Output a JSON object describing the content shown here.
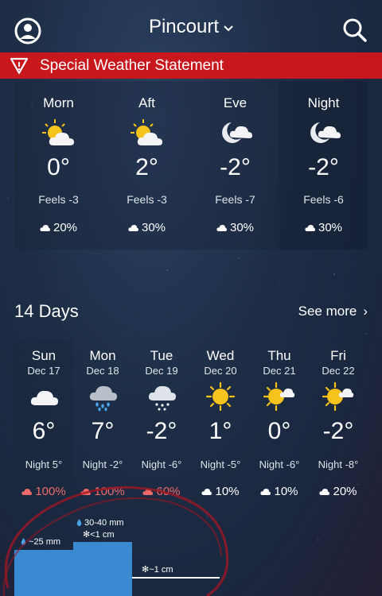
{
  "header": {
    "location": "Pincourt",
    "location_chevron": "⌄",
    "avatar_icon": "user-circle-icon",
    "search_icon": "search-icon"
  },
  "alert": {
    "text": "Special Weather Statement",
    "color": "#c8181d"
  },
  "periods": [
    {
      "label": "Morn",
      "temp": "0°",
      "feels": "Feels -3",
      "precip": "20%",
      "icon": "partly-sunny-icon"
    },
    {
      "label": "Aft",
      "temp": "2°",
      "feels": "Feels -3",
      "precip": "30%",
      "icon": "partly-sunny-icon"
    },
    {
      "label": "Eve",
      "temp": "-2°",
      "feels": "Feels -7",
      "precip": "30%",
      "icon": "moon-cloud-icon"
    },
    {
      "label": "Night",
      "temp": "-2°",
      "feels": "Feels -6",
      "precip": "30%",
      "icon": "moon-cloud-icon"
    }
  ],
  "fourteen_days": {
    "title": "14 Days",
    "see_more": "See more",
    "chevron": "›"
  },
  "days": [
    {
      "name": "Sun",
      "date": "Dec 17",
      "temp": "6°",
      "night": "Night 5°",
      "precip": "100%",
      "icon": "cloud-icon",
      "high": true
    },
    {
      "name": "Mon",
      "date": "Dec 18",
      "temp": "7°",
      "night": "Night -2°",
      "precip": "100%",
      "icon": "rain-cloud-icon",
      "high": true
    },
    {
      "name": "Tue",
      "date": "Dec 19",
      "temp": "-2°",
      "night": "Night -6°",
      "precip": "60%",
      "icon": "snow-cloud-icon",
      "high": true
    },
    {
      "name": "Wed",
      "date": "Dec 20",
      "temp": "1°",
      "night": "Night -5°",
      "precip": "10%",
      "icon": "sun-icon",
      "high": false
    },
    {
      "name": "Thu",
      "date": "Dec 21",
      "temp": "0°",
      "night": "Night -6°",
      "precip": "10%",
      "icon": "sun-cloud-icon",
      "high": false
    },
    {
      "name": "Fri",
      "date": "Dec 22",
      "temp": "-2°",
      "night": "Night -8°",
      "precip": "20%",
      "icon": "sun-cloud-icon",
      "high": false
    }
  ],
  "precip_amounts": {
    "sun": "~25 mm",
    "mon_rain": "30-40 mm",
    "mon_snow": "<1 cm",
    "tue_snow": "~1 cm"
  },
  "colors": {
    "precip_high": "#f06a6a",
    "bar": "#3a8ad2",
    "sun": "#f6c21c"
  }
}
